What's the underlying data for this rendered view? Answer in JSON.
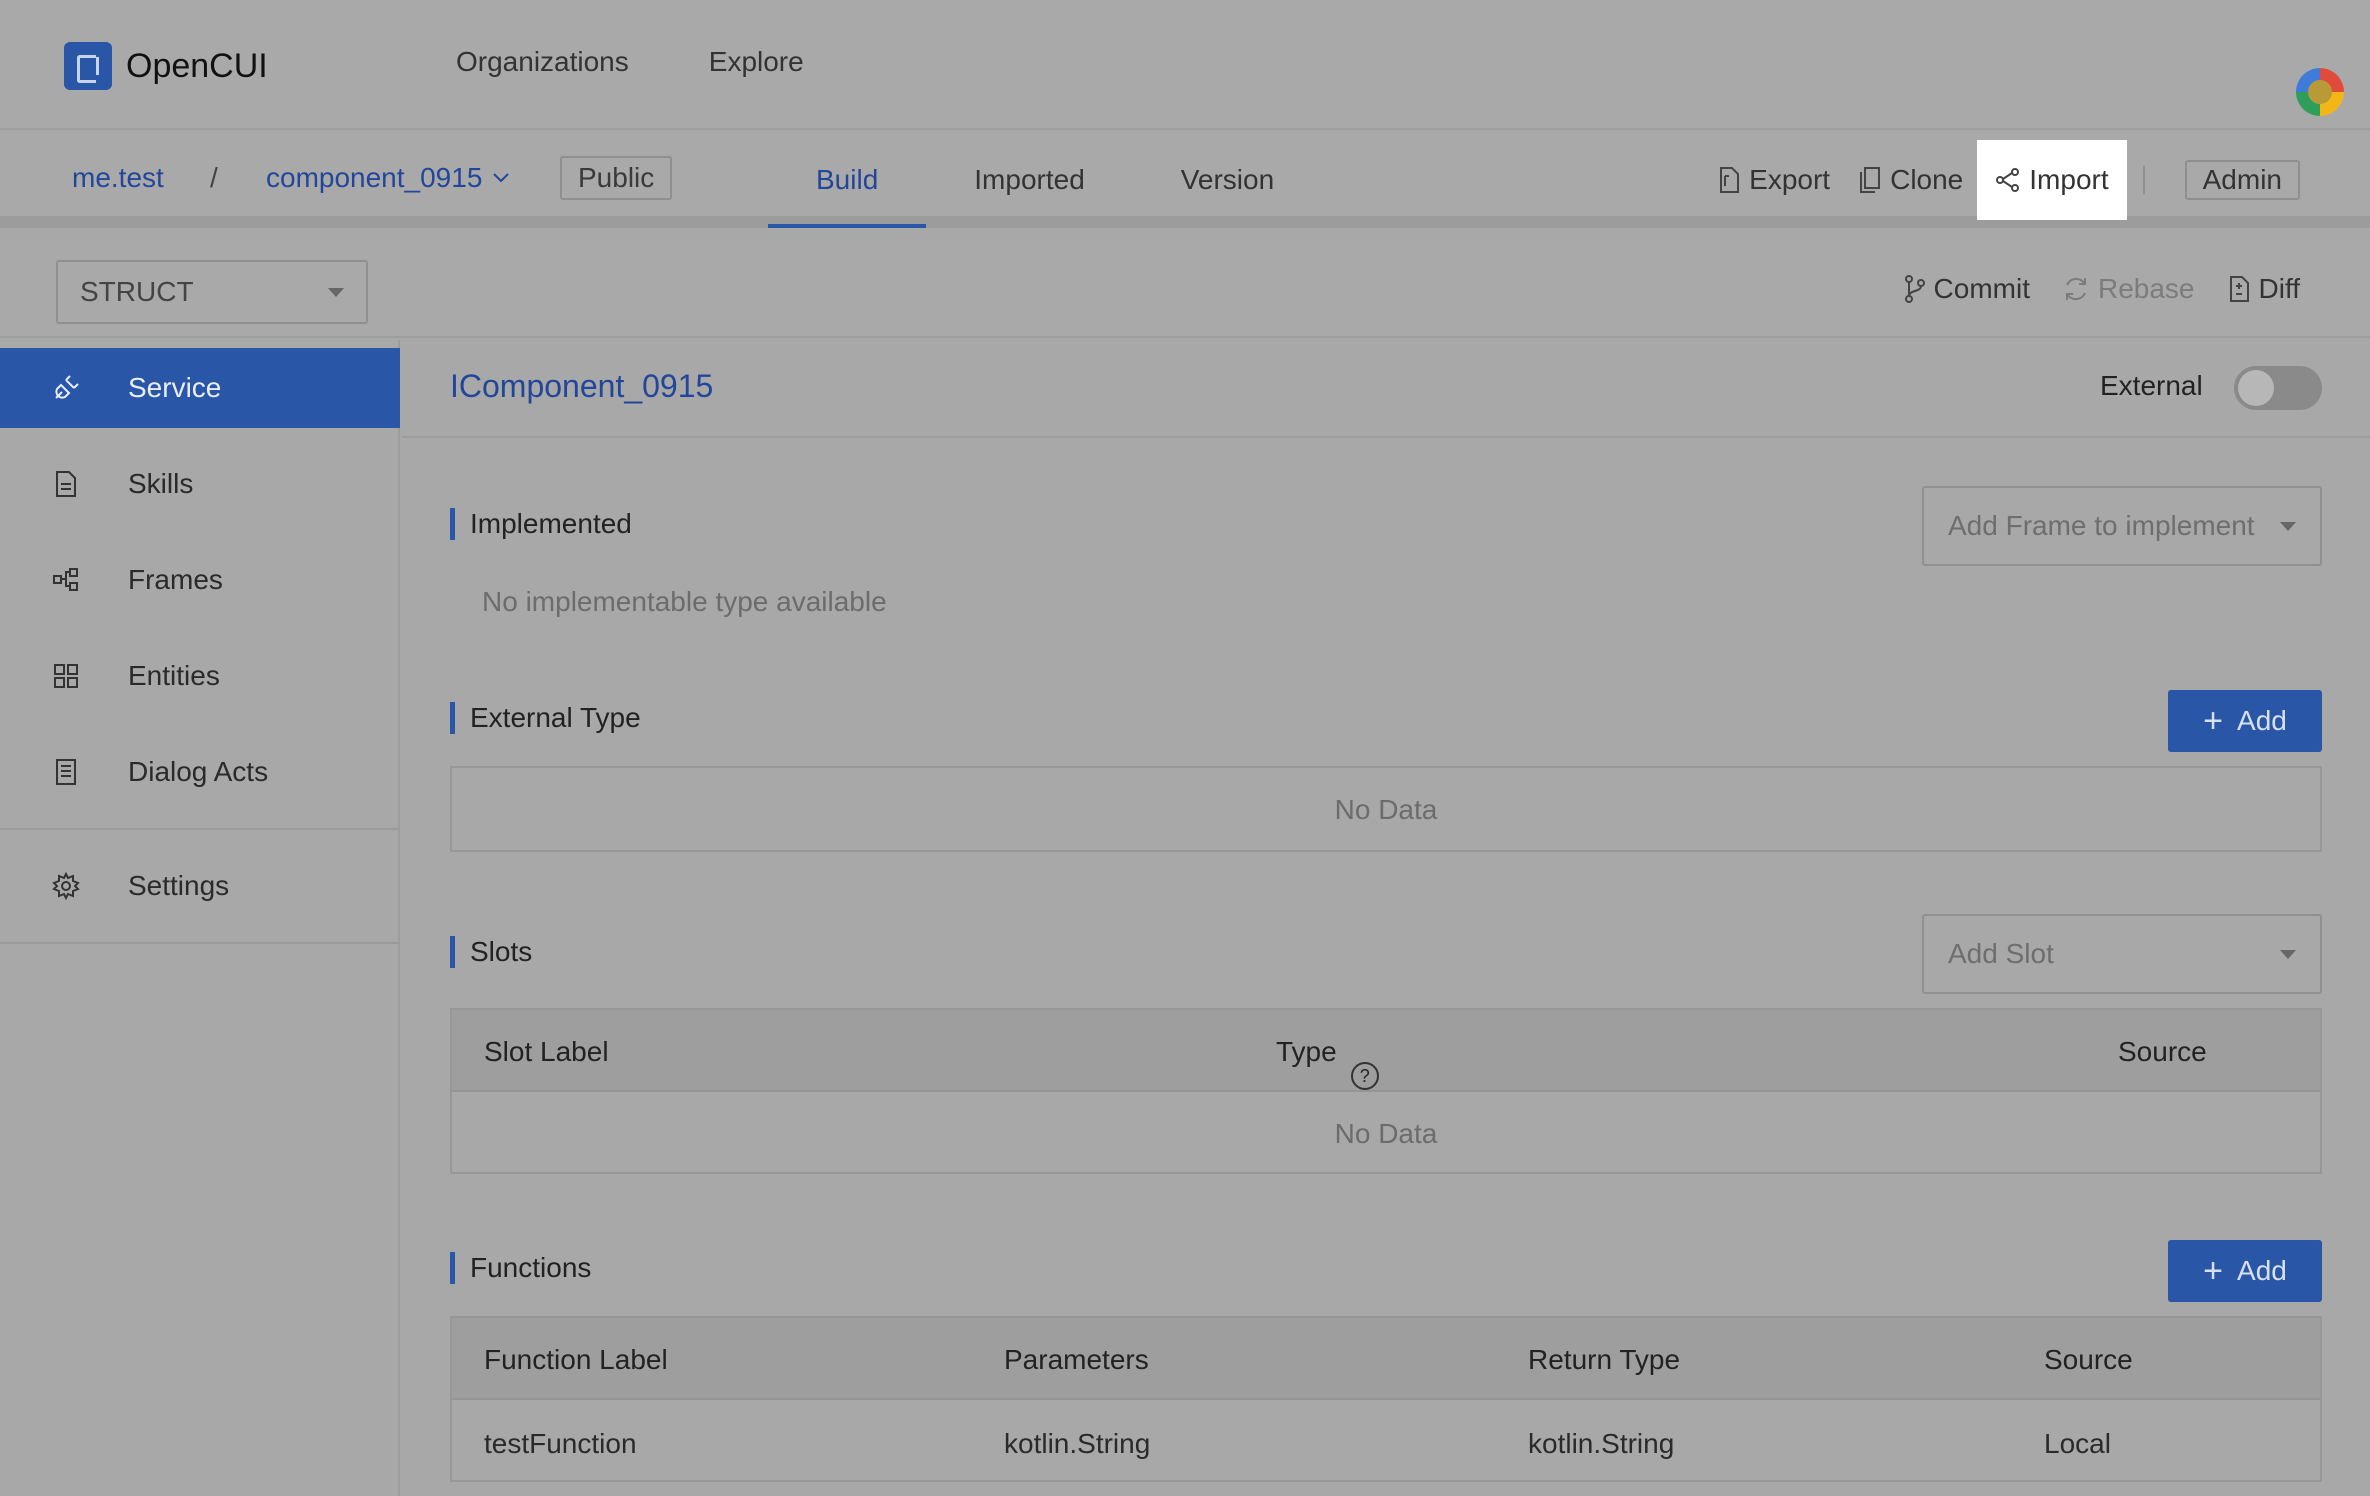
{
  "header": {
    "brand": "OpenCUI",
    "nav": [
      "Organizations",
      "Explore"
    ]
  },
  "project": {
    "org": "me.test",
    "separator": "/",
    "name": "component_0915",
    "visibility": "Public",
    "tabs": [
      {
        "label": "Build",
        "active": true
      },
      {
        "label": "Imported",
        "active": false
      },
      {
        "label": "Version",
        "active": false
      }
    ],
    "actions": {
      "export": "Export",
      "clone": "Clone",
      "import": "Import",
      "admin": "Admin"
    }
  },
  "toolbar": {
    "type_select": "STRUCT",
    "commit": "Commit",
    "rebase": "Rebase",
    "diff": "Diff"
  },
  "sidebar": {
    "items": [
      {
        "label": "Service",
        "icon": "plug-icon",
        "active": true
      },
      {
        "label": "Skills",
        "icon": "document-icon",
        "active": false
      },
      {
        "label": "Frames",
        "icon": "frames-icon",
        "active": false
      },
      {
        "label": "Entities",
        "icon": "entities-icon",
        "active": false
      },
      {
        "label": "Dialog Acts",
        "icon": "dialog-acts-icon",
        "active": false
      },
      {
        "label": "Settings",
        "icon": "gear-icon",
        "active": false
      }
    ]
  },
  "main": {
    "title": "IComponent_0915",
    "external_label": "External",
    "external_enabled": false,
    "implemented": {
      "title": "Implemented",
      "dropdown_placeholder": "Add Frame to implement",
      "empty": "No implementable type available"
    },
    "external_type": {
      "title": "External Type",
      "add_label": "Add",
      "empty": "No Data"
    },
    "slots": {
      "title": "Slots",
      "dropdown_placeholder": "Add Slot",
      "columns": [
        "Slot Label",
        "Type",
        "Source"
      ],
      "empty": "No Data"
    },
    "functions": {
      "title": "Functions",
      "add_label": "Add",
      "columns": [
        "Function Label",
        "Parameters",
        "Return Type",
        "Source"
      ],
      "rows": [
        [
          "testFunction",
          "kotlin.String",
          "kotlin.String",
          "Local"
        ]
      ]
    }
  },
  "colors": {
    "accent": "#2a56a8",
    "link": "#22479a",
    "overlay_bg": "#a8a8a8"
  }
}
